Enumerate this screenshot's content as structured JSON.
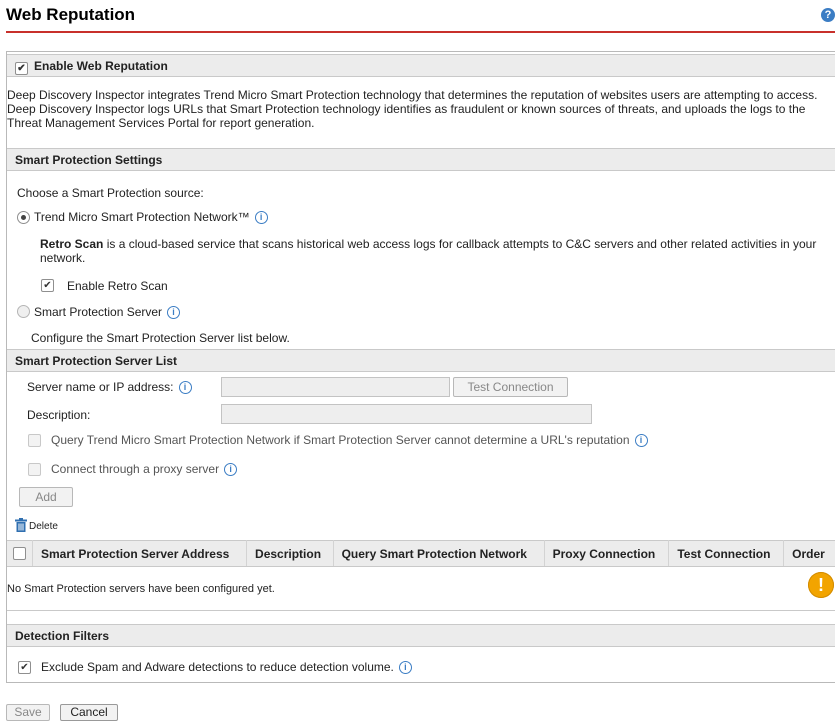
{
  "page": {
    "title": "Web Reputation",
    "help_icon": "help-icon"
  },
  "enable": {
    "label": "Enable Web Reputation",
    "checked": true
  },
  "description": "Deep Discovery Inspector integrates Trend Micro Smart Protection technology that determines the reputation of websites users are attempting to access. Deep Discovery Inspector logs URLs that Smart Protection technology identifies as fraudulent or known sources of threats, and uploads the logs to the Threat Management Services Portal for report generation.",
  "settings": {
    "header": "Smart Protection Settings",
    "choose_label": "Choose a Smart Protection source:",
    "option_network": "Trend Micro Smart Protection Network™",
    "retro_bold": "Retro Scan",
    "retro_text": " is a cloud-based service that scans historical web access logs for callback attempts to C&C servers and other related activities in your network.",
    "retro_checkbox": "Enable Retro Scan",
    "option_server": "Smart Protection Server",
    "server_note": "Configure the Smart Protection Server list below."
  },
  "server_list": {
    "header": "Smart Protection Server List",
    "name_label": "Server name or IP address:",
    "name_value": "",
    "test_button": "Test Connection",
    "desc_label": "Description:",
    "desc_value": "",
    "query_checkbox": "Query Trend Micro Smart Protection Network if Smart Protection Server cannot determine a URL's reputation",
    "proxy_checkbox": "Connect through a proxy server",
    "add_button": "Add",
    "delete_label": "Delete",
    "columns": [
      "Smart Protection Server Address",
      "Description",
      "Query Smart Protection Network",
      "Proxy Connection",
      "Test Connection",
      "Order"
    ],
    "empty_message": "No Smart Protection servers have been configured yet."
  },
  "filters": {
    "header": "Detection Filters",
    "exclude_checkbox": "Exclude Spam and Adware detections to reduce detection volume."
  },
  "footer": {
    "save": "Save",
    "cancel": "Cancel"
  },
  "colors": {
    "accent_line": "#c8302b",
    "info_blue": "#3b7dc4",
    "warning": "#f2a400"
  }
}
